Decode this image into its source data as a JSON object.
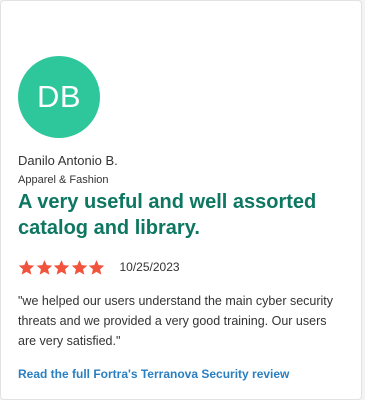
{
  "review": {
    "avatar_initials": "DB",
    "avatar_color": "#2ec69b",
    "reviewer_name": "Danilo Antonio B.",
    "industry": "Apparel & Fashion",
    "title": "A very useful and well assorted catalog and library.",
    "rating": 5,
    "rating_max": 5,
    "star_color": "#f1533c",
    "date": "10/25/2023",
    "quote": "\"we helped our users understand the main cyber security threats and we provided a very good training. Our users are very satisfied.\"",
    "link_text": "Read the full Fortra's Terranova Security review",
    "link_color": "#2a7fc1",
    "title_color": "#0e7761"
  }
}
